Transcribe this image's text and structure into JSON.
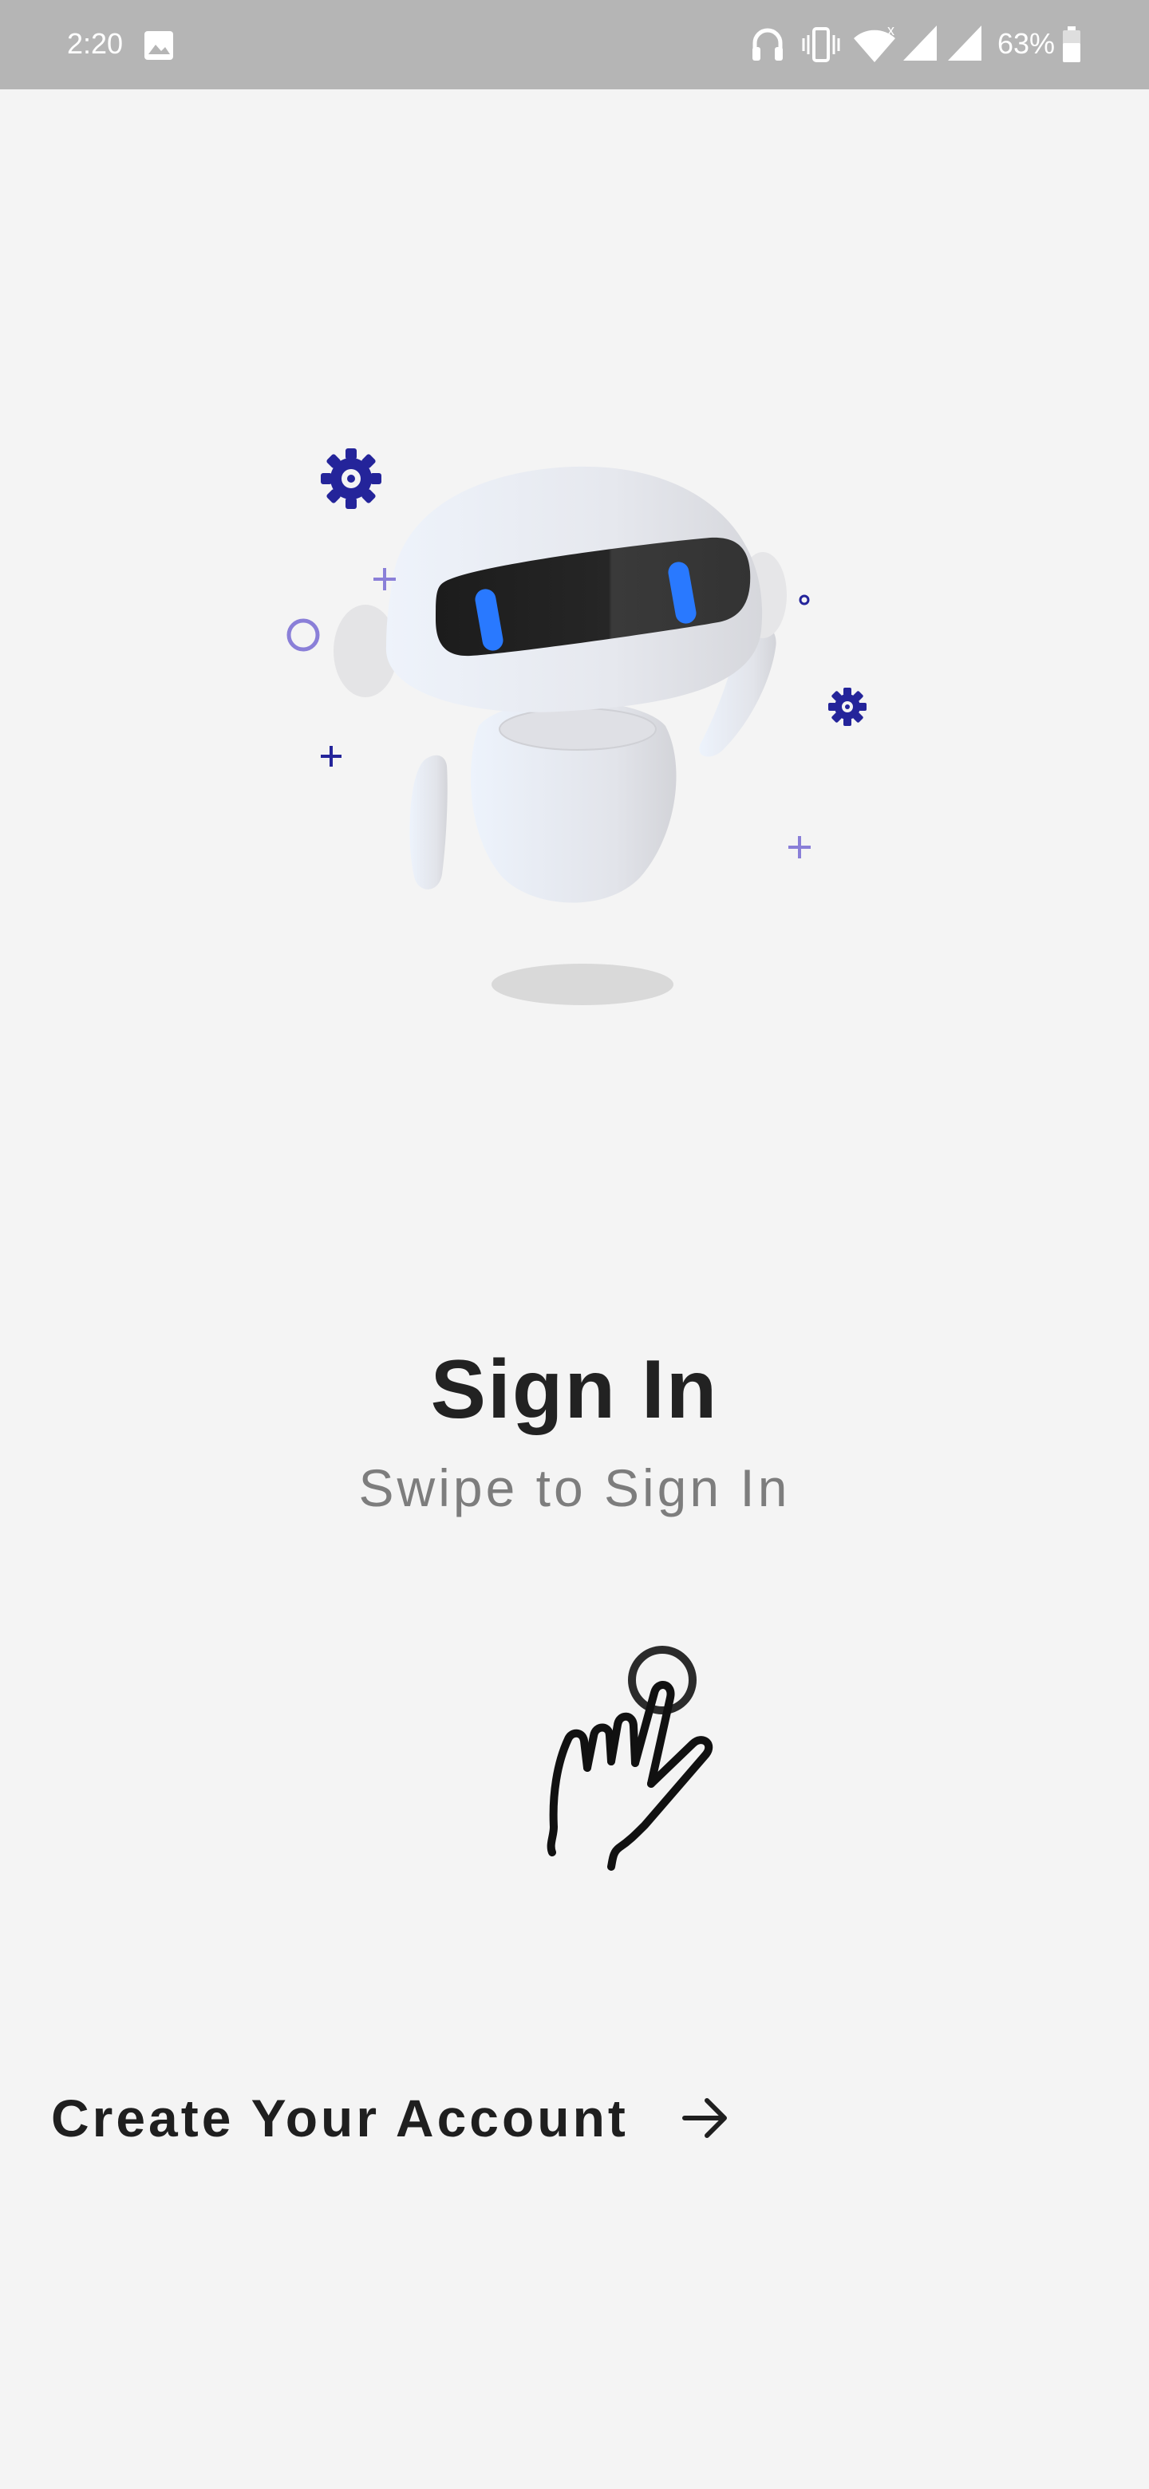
{
  "status_bar": {
    "time": "2:20",
    "battery_percent": "63%",
    "icons": [
      "image-icon",
      "headphones-icon",
      "vibrate-icon",
      "wifi-icon",
      "signal-icon",
      "signal-icon",
      "battery-icon"
    ]
  },
  "illustration": {
    "name": "robot-illustration",
    "accent_color": "#2a2a9a",
    "eye_color": "#2979ff"
  },
  "signin": {
    "title": "Sign In",
    "subtitle": "Swipe to Sign In"
  },
  "gesture": {
    "icon": "swipe-hand-icon"
  },
  "create_account": {
    "label": "Create Your Account",
    "icon": "arrow-right-icon"
  }
}
